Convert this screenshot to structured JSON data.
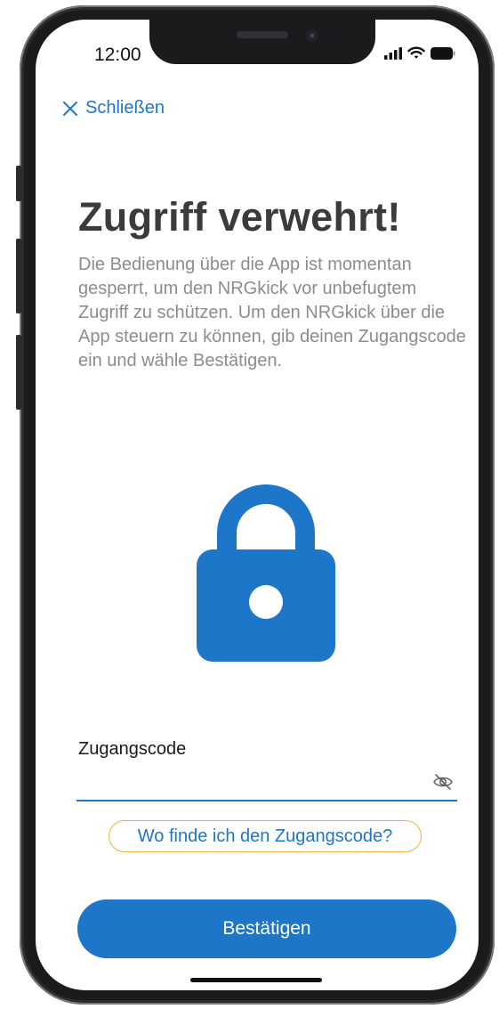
{
  "status_bar": {
    "time": "12:00",
    "icons": [
      "cellular-signal-icon",
      "wifi-icon",
      "battery-icon"
    ]
  },
  "nav": {
    "close_label": "Schließen",
    "close_icon": "close-x-icon"
  },
  "content": {
    "title": "Zugriff verwehrt!",
    "description": "Die Bedienung über die App ist momentan gesperrt, um den NRGkick vor unbefugtem Zugriff zu schützen. Um den NRGkick über die App steuern zu können, gib deinen Zugangscode ein und wähle Bestätigen.",
    "illustration_icon": "padlock-icon"
  },
  "form": {
    "field_label": "Zugangscode",
    "field_value": "",
    "visibility_icon": "eye-slash-icon",
    "help_link": "Wo finde ich den Zugangscode?",
    "submit_label": "Bestätigen"
  },
  "colors": {
    "accent": "#1d76c8",
    "title": "#3b3b3b",
    "body_text": "#8c8c8c",
    "help_outline": "#f0b23e",
    "background": "#ffffff"
  }
}
